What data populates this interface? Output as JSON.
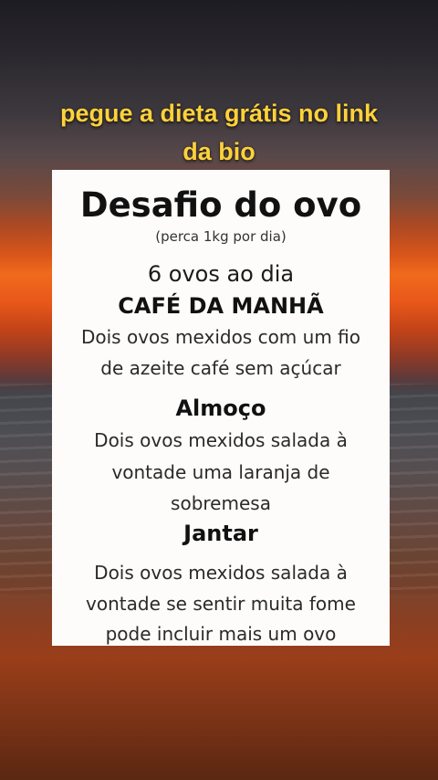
{
  "overlay": {
    "headline_line1": "pegue a dieta grátis no link",
    "headline_line2": "da bio",
    "headline_color": "#ffd23a"
  },
  "card": {
    "title": "Desafio do ovo",
    "subtitle": "(perca 1kg por dia)",
    "daily_count": "6 ovos ao dia",
    "sections": [
      {
        "heading": "CAFÉ DA MANHÃ",
        "lines": [
          "Dois ovos mexidos com um fio",
          "de azeite café sem açúcar"
        ]
      },
      {
        "heading": "Almoço",
        "lines": [
          "Dois ovos mexidos salada à",
          "vontade uma laranja de",
          "sobremesa"
        ]
      },
      {
        "heading": "Jantar",
        "lines": [
          "Dois ovos mexidos salada à",
          "vontade se sentir muita fome",
          "pode incluir mais um ovo"
        ]
      }
    ]
  }
}
